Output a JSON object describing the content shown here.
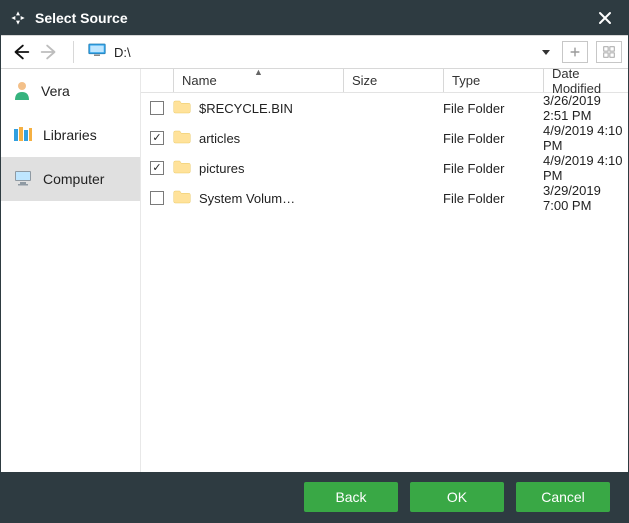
{
  "title": "Select Source",
  "path": "D:\\",
  "sidebar": {
    "items": [
      {
        "label": "Vera"
      },
      {
        "label": "Libraries"
      },
      {
        "label": "Computer"
      }
    ],
    "selected_index": 2
  },
  "columns": {
    "name": "Name",
    "size": "Size",
    "type": "Type",
    "date": "Date Modified"
  },
  "rows": [
    {
      "checked": false,
      "name": "$RECYCLE.BIN",
      "size": "",
      "type": "File Folder",
      "date": "3/26/2019 2:51 PM"
    },
    {
      "checked": true,
      "name": "articles",
      "size": "",
      "type": "File Folder",
      "date": "4/9/2019 4:10 PM"
    },
    {
      "checked": true,
      "name": "pictures",
      "size": "",
      "type": "File Folder",
      "date": "4/9/2019 4:10 PM"
    },
    {
      "checked": false,
      "name": "System Volum…",
      "size": "",
      "type": "File Folder",
      "date": "3/29/2019 7:00 PM"
    }
  ],
  "footer": {
    "back": "Back",
    "ok": "OK",
    "cancel": "Cancel"
  }
}
